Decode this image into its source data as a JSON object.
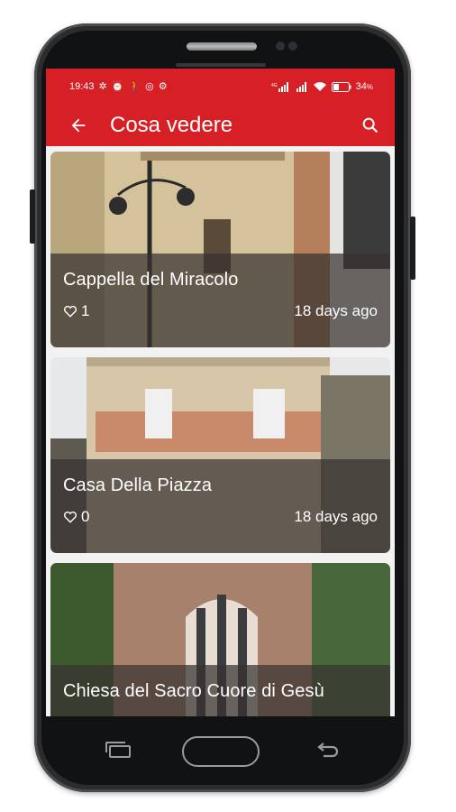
{
  "status_bar": {
    "time": "19:43",
    "battery": "34"
  },
  "app_bar": {
    "title": "Cosa vedere",
    "back_icon": "arrow-back-icon",
    "search_icon": "search-icon"
  },
  "places": [
    {
      "name": "Cappella del Miracolo",
      "likes": "1",
      "date": "18 days ago"
    },
    {
      "name": "Casa Della Piazza",
      "likes": "0",
      "date": "18 days ago"
    },
    {
      "name": "Chiesa del Sacro Cuore di Gesù",
      "likes": "",
      "date": ""
    }
  ],
  "colors": {
    "primary": "#d71f26",
    "overlay": "#37302e"
  }
}
